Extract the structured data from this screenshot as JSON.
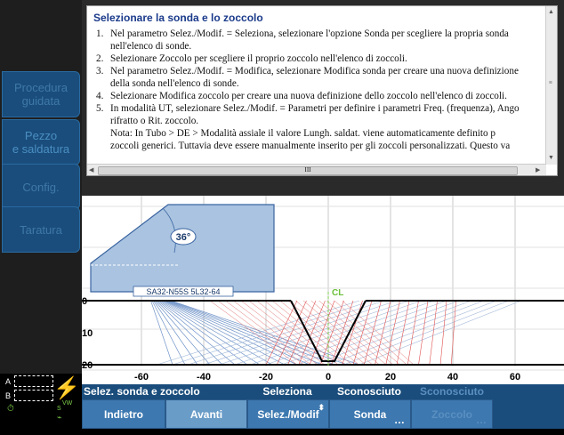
{
  "sidebar": {
    "tabs": [
      {
        "label": "Procedura\nguidata"
      },
      {
        "label": "Pezzo\ne saldatura"
      },
      {
        "label": "Config."
      },
      {
        "label": "Taratura"
      }
    ]
  },
  "help": {
    "title": "Selezionare la sonda e lo zoccolo",
    "items": [
      {
        "num": "1.",
        "lines": [
          "Nel parametro Selez./Modif. = Seleziona, selezionare l'opzione Sonda per scegliere la propria sonda",
          "nell'elenco di sonde."
        ]
      },
      {
        "num": "2.",
        "lines": [
          "Selezionare Zoccolo per scegliere il proprio zoccolo nell'elenco di zoccoli."
        ]
      },
      {
        "num": "3.",
        "lines": [
          "Nel parametro Selez./Modif. = Modifica, selezionare Modifica sonda per creare una nuova definizione",
          "della sonda nell'elenco di sonde."
        ]
      },
      {
        "num": "4.",
        "lines": [
          "Selezionare Modifica zoccolo per creare una nuova definizione dello zoccolo nell'elenco di zoccoli."
        ]
      },
      {
        "num": "5.",
        "lines": [
          "In modalità UT, selezionare Selez./Modif. = Parametri per definire i parametri Freq. (frequenza), Ango",
          "rifratto o Rit. zoccolo."
        ]
      }
    ],
    "note_lines": [
      "Nota: In Tubo > DE > Modalità assiale il valore Lungh. saldat. viene automaticamente definito p",
      "zoccoli generici. Tuttavia deve essere manualmente inserito per gli zoccoli personalizzati. Questo va"
    ],
    "hscroll_grip": "III"
  },
  "plot": {
    "angle_label": "36°",
    "probe_label": "SA32-N55S 5L32-64",
    "cl_label": "CL",
    "x_ticks": [
      "-60",
      "-40",
      "-20",
      "0",
      "20",
      "40",
      "60"
    ],
    "y_ticks": [
      "0",
      "10",
      "20"
    ]
  },
  "status": {
    "a_label": "A",
    "b_label": "B",
    "vw_label": "VW",
    "s_label": "S"
  },
  "bottom": {
    "tabs": [
      {
        "label": "Selez. sonda e zoccolo"
      },
      {
        "label": "Seleziona"
      },
      {
        "label": "Sconosciuto"
      },
      {
        "label": "Sconosciuto"
      }
    ],
    "buttons": [
      {
        "label": "Indietro"
      },
      {
        "label": "Avanti"
      },
      {
        "label": "Selez./Modif"
      },
      {
        "label": "Sonda"
      },
      {
        "label": "Zoccolo"
      }
    ]
  }
}
